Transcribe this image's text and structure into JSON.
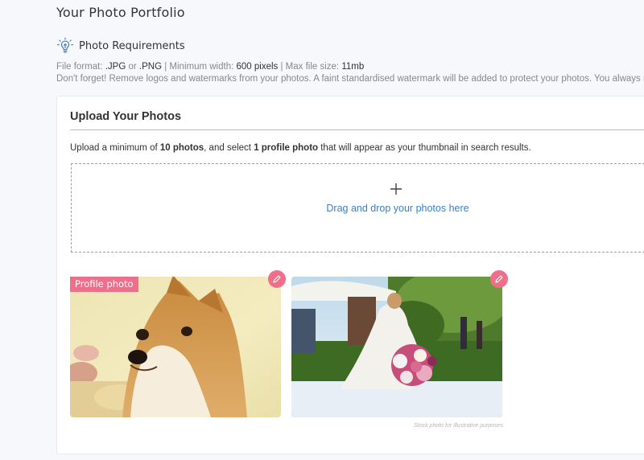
{
  "page": {
    "title": "Your Photo Portfolio"
  },
  "requirements": {
    "icon": "lightbulb-icon",
    "title": "Photo Requirements",
    "format_label": "File format: ",
    "format_jpg": ".JPG",
    "format_or": " or ",
    "format_png": ".PNG",
    "sep1": " | Minimum width: ",
    "min_width": "600 pixels",
    "sep2": " | Max file size: ",
    "max_size": "11mb",
    "note": "Don't forget! Remove logos and watermarks from your photos. A faint standardised watermark will be added to protect your photos. You always retain"
  },
  "upload": {
    "title": "Upload Your Photos",
    "instr_1": "Upload a minimum of ",
    "instr_min": "10 photos",
    "instr_2": ", and select ",
    "instr_profile": "1 profile photo",
    "instr_3": " that will appear as your thumbnail in search results.",
    "dropzone_icon": "plus-icon",
    "dropzone_text": "Drag and drop your photos here",
    "profile_badge": "Profile photo",
    "edit_icon": "pencil-icon",
    "caption": "Stock photo for illustrative purposes"
  },
  "colors": {
    "accent_pink": "#ef6e8a",
    "link_blue": "#3d7fc4",
    "page_bg": "#f6f8fc"
  }
}
